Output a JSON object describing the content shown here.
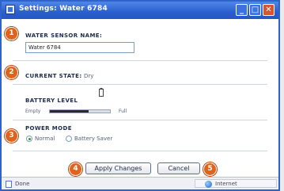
{
  "window": {
    "title": "Settings: Water 6784",
    "minimize_label": "_",
    "maximize_label": "□",
    "close_label": "✕"
  },
  "callouts": [
    "1",
    "2",
    "3",
    "4",
    "5"
  ],
  "sensor_name": {
    "label": "WATER SENSOR NAME:",
    "value": "Water 6784"
  },
  "current_state": {
    "label": "CURRENT STATE:",
    "value": "Dry"
  },
  "battery": {
    "label": "BATTERY LEVEL",
    "min_label": "Empty",
    "max_label": "Full",
    "level": 0.65
  },
  "power_mode": {
    "label": "POWER MODE",
    "options": [
      {
        "label": "Normal",
        "selected": true
      },
      {
        "label": "Battery Saver",
        "selected": false
      }
    ]
  },
  "buttons": {
    "apply": "Apply Changes",
    "cancel": "Cancel"
  },
  "statusbar": {
    "left": "Done",
    "right": "Internet"
  },
  "colors": {
    "titlebar": "#2a5fcf",
    "callout": "#e0621b"
  }
}
